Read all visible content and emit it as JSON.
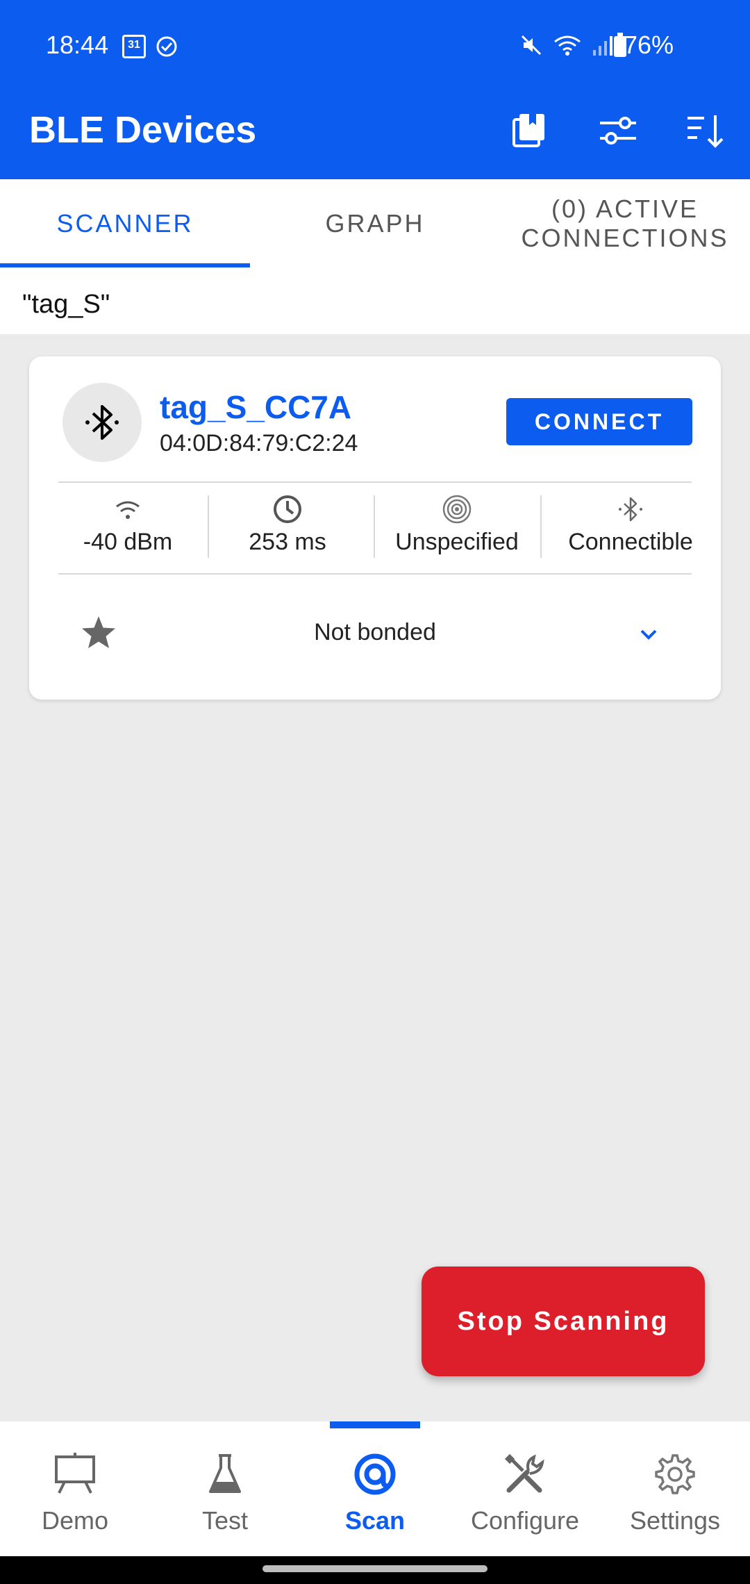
{
  "status_bar": {
    "time": "18:44",
    "calendar_day": "31",
    "battery": "76%"
  },
  "appbar": {
    "title": "BLE Devices"
  },
  "tabs": [
    {
      "label": "SCANNER",
      "active": true
    },
    {
      "label": "GRAPH",
      "active": false
    },
    {
      "label_line1": "(0) ACTIVE",
      "label_line2": "CONNECTIONS",
      "active": false
    }
  ],
  "filter": {
    "text": "\"tag_S\""
  },
  "device": {
    "name": "tag_S_CC7A",
    "mac": "04:0D:84:79:C2:24",
    "connect_label": "CONNECT",
    "stats": [
      {
        "icon": "wifi-signal-icon",
        "value": "-40 dBm"
      },
      {
        "icon": "clock-icon",
        "value": "253 ms"
      },
      {
        "icon": "beacon-icon",
        "value": "Unspecified"
      },
      {
        "icon": "bluetooth-icon",
        "value": "Connectible"
      }
    ],
    "bond_status": "Not bonded"
  },
  "fab": {
    "label": "Stop Scanning"
  },
  "bottom_nav": [
    {
      "label": "Demo",
      "icon": "presentation-icon",
      "active": false
    },
    {
      "label": "Test",
      "icon": "flask-icon",
      "active": false
    },
    {
      "label": "Scan",
      "icon": "scan-icon",
      "active": true
    },
    {
      "label": "Configure",
      "icon": "tools-icon",
      "active": false
    },
    {
      "label": "Settings",
      "icon": "gear-icon",
      "active": false
    }
  ],
  "colors": {
    "primary": "#0c5cf0",
    "fab": "#dc1f2a",
    "background": "#ebebeb"
  }
}
